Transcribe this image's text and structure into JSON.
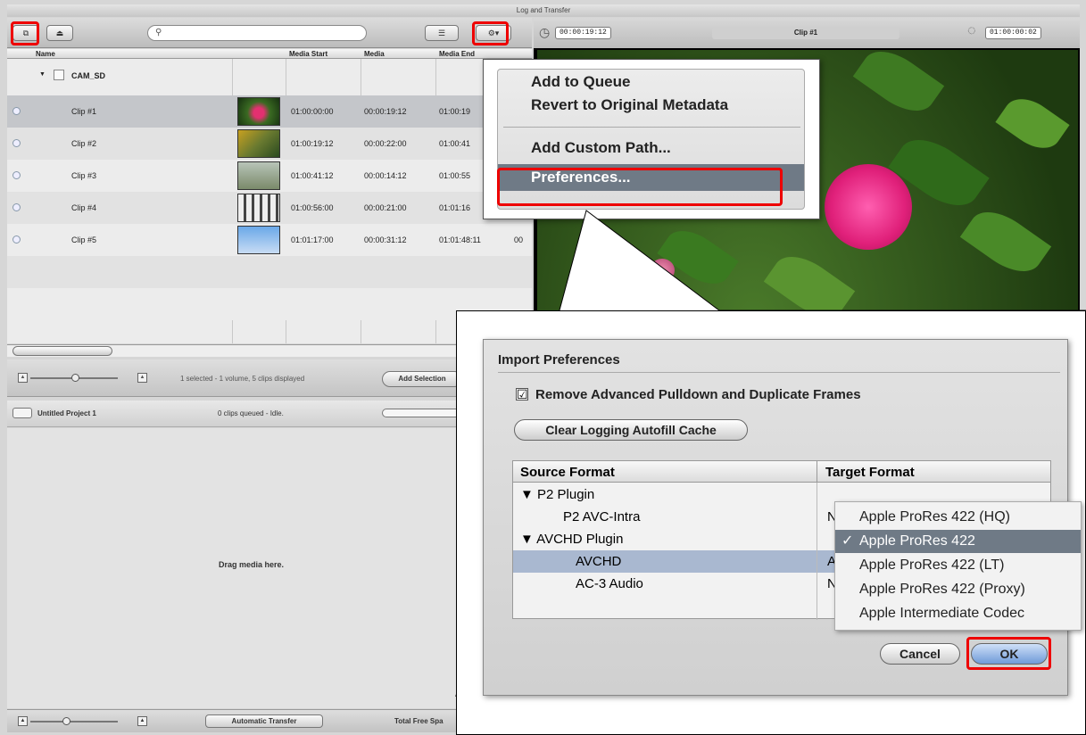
{
  "window": {
    "title": "Log and Transfer"
  },
  "toolbar": {
    "search_placeholder": ""
  },
  "table": {
    "headers": [
      "Name",
      "Media Start",
      "Media",
      "Media End"
    ],
    "group": "CAM_SD",
    "clips": [
      {
        "name": "Clip #1",
        "start": "01:00:00:00",
        "duration": "00:00:19:12",
        "end": "01:00:19"
      },
      {
        "name": "Clip #2",
        "start": "01:00:19:12",
        "duration": "00:00:22:00",
        "end": "01:00:41"
      },
      {
        "name": "Clip #3",
        "start": "01:00:41:12",
        "duration": "00:00:14:12",
        "end": "01:00:55"
      },
      {
        "name": "Clip #4",
        "start": "01:00:56:00",
        "duration": "00:00:21:00",
        "end": "01:01:16"
      },
      {
        "name": "Clip #5",
        "start": "01:01:17:00",
        "duration": "00:00:31:12",
        "end": "01:01:48:11",
        "extra": "00"
      }
    ]
  },
  "status": {
    "summary": "1 selected - 1 volume, 5 clips displayed",
    "add_selection": "Add Selection"
  },
  "project": {
    "name": "Untitled Project 1",
    "queue_status": "0 clips queued - Idle."
  },
  "queue": {
    "drop_hint": "Drag media here."
  },
  "bottom": {
    "auto_transfer": "Automatic Transfer",
    "free_space": "Total Free Spa"
  },
  "viewer": {
    "current_tc": "00:00:19:12",
    "clip_name": "Clip #1",
    "duration_tc": "01:00:00:02"
  },
  "context_menu": {
    "items": [
      "Add to Queue",
      "Revert to Original Metadata",
      "Add Custom Path...",
      "Preferences..."
    ]
  },
  "import_prefs": {
    "title": "Import Preferences",
    "remove_pulldown": "Remove Advanced Pulldown and Duplicate Frames",
    "clear_cache": "Clear Logging Autofill Cache",
    "col_source": "Source Format",
    "col_target": "Target Format",
    "rows": [
      {
        "source": "▼ P2 Plugin",
        "target": ""
      },
      {
        "source": "P2 AVC-Intra",
        "target": "N"
      },
      {
        "source": "▼ AVCHD Plugin",
        "target": ""
      },
      {
        "source": "AVCHD",
        "target": "A"
      },
      {
        "source": "AC-3 Audio",
        "target": "N"
      }
    ],
    "cancel": "Cancel",
    "ok": "OK"
  },
  "codec_popup": {
    "options": [
      "Apple ProRes 422 (HQ)",
      "Apple ProRes 422",
      "Apple ProRes 422 (LT)",
      "Apple ProRes 422 (Proxy)",
      "Apple Intermediate Codec"
    ],
    "selected_index": 1,
    "check": "✓"
  },
  "colors": {
    "highlight_red": "#e00000",
    "selection_blue": "#a9b8d0",
    "menu_highlight": "#6f7a86"
  }
}
